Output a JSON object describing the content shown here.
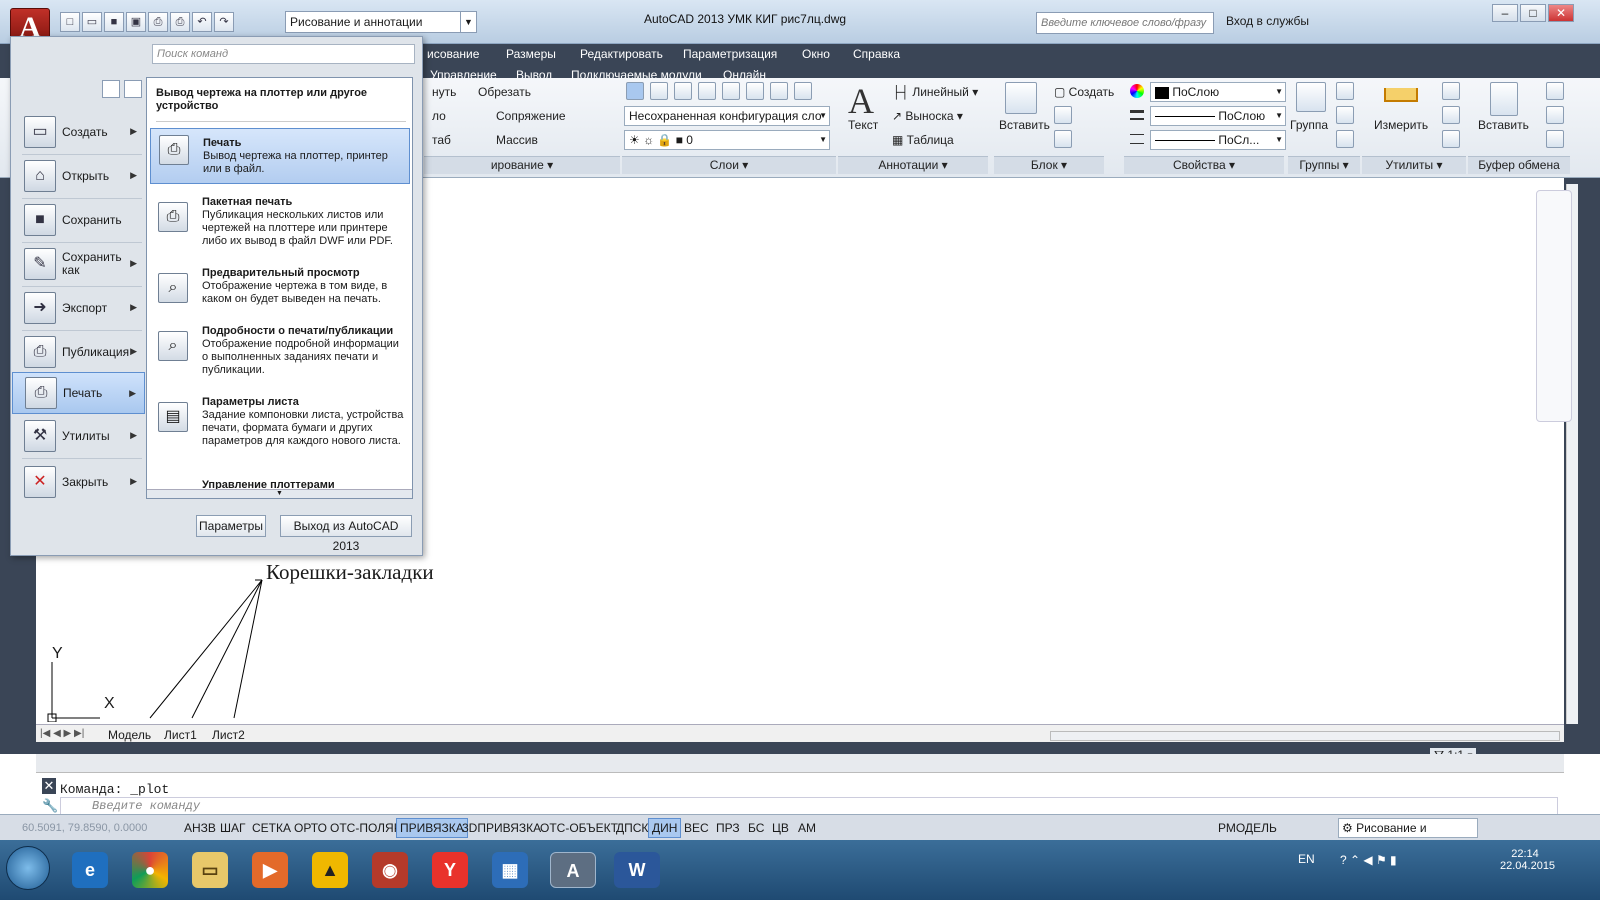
{
  "title_bar": {
    "app_title": "AutoCAD 2013     УМК КИГ рис7лц.dwg",
    "workspace": "Рисование и аннотации",
    "search_placeholder": "Введите ключевое слово/фразу",
    "services": "Вход в службы",
    "app_logo": "A"
  },
  "menubar": {
    "row1": [
      "исование",
      "Размеры",
      "Редактировать",
      "Параметризация",
      "Окно",
      "Справка"
    ],
    "row2": [
      "Управление",
      "Вывод",
      "Подключаемые модули",
      "Онлайн"
    ]
  },
  "ribbon": {
    "modify": {
      "items": [
        "нуть",
        "Обрезать",
        "ло",
        "Сопряжение",
        "таб",
        "Массив"
      ],
      "title": "ирование"
    },
    "layers": {
      "layer_state": "Несохраненная конфигурация сло",
      "current_layer": "0",
      "title": "Слои"
    },
    "annotation": {
      "text_label": "Текст",
      "linear": "Линейный",
      "leader": "Выноска",
      "table": "Таблица",
      "title": "Аннотации"
    },
    "block": {
      "insert": "Вставить",
      "create": "Создать",
      "title": "Блок"
    },
    "properties": {
      "color": "ПоСлою",
      "lineweight": "ПоСлою",
      "linetype": "ПоСл...",
      "title": "Свойства"
    },
    "groups": {
      "group": "Группа",
      "title": "Группы"
    },
    "utilities": {
      "measure": "Измерить",
      "title": "Утилиты"
    },
    "clipboard": {
      "paste": "Вставить",
      "title": "Буфер обмена"
    }
  },
  "app_menu": {
    "search_placeholder": "Поиск команд",
    "items": [
      {
        "label": "Создать",
        "icon": "new-document-icon"
      },
      {
        "label": "Открыть",
        "icon": "open-folder-icon"
      },
      {
        "label": "Сохранить",
        "icon": "save-disk-icon"
      },
      {
        "label": "Сохранить как",
        "icon": "save-as-icon"
      },
      {
        "label": "Экспорт",
        "icon": "export-icon"
      },
      {
        "label": "Публикация",
        "icon": "publish-icon"
      },
      {
        "label": "Печать",
        "icon": "printer-icon"
      },
      {
        "label": "Утилиты",
        "icon": "utilities-icon"
      },
      {
        "label": "Закрыть",
        "icon": "close-document-icon"
      }
    ],
    "print_submenu": {
      "heading": "Вывод чертежа на плоттер или другое устройство",
      "items": [
        {
          "title": "Печать",
          "desc": "Вывод чертежа на плоттер, принтер или в файл."
        },
        {
          "title": "Пакетная печать",
          "desc": "Публикация нескольких листов или чертежей на плоттере или принтере либо их вывод в файл DWF или PDF."
        },
        {
          "title": "Предварительный просмотр",
          "desc": "Отображение чертежа в том виде, в каком он будет выведен на печать."
        },
        {
          "title": "Подробности о печати/публикации",
          "desc": "Отображение подробной информации о выполненных заданиях печати и публикации."
        },
        {
          "title": "Параметры листа",
          "desc": "Задание компоновки листа, устройства печати, формата бумаги и других параметров для каждого нового листа."
        },
        {
          "title": "Управление плоттерами",
          "desc": ""
        }
      ]
    },
    "options_button": "Параметры",
    "exit_button": "Выход из AutoCAD 2013"
  },
  "drawing": {
    "annotation": "Корешки-закладки",
    "ucs_x": "X",
    "ucs_y": "Y"
  },
  "tabs": [
    "Модель",
    "Лист1",
    "Лист2"
  ],
  "command_line": {
    "history": "Команда:  _plot",
    "placeholder": "Введите команду"
  },
  "status_bar": {
    "coords": "60.5091, 79.8590, 0.0000",
    "toggles": [
      {
        "label": "АНЗВ",
        "on": false
      },
      {
        "label": "ШАГ",
        "on": false
      },
      {
        "label": "СЕТКА",
        "on": false
      },
      {
        "label": "ОРТО",
        "on": false
      },
      {
        "label": "ОТС-ПОЛЯР",
        "on": false
      },
      {
        "label": "ПРИВЯЗКА",
        "on": true
      },
      {
        "label": "3DПРИВЯЗКА",
        "on": false
      },
      {
        "label": "ОТС-ОБЪЕКТ",
        "on": false
      },
      {
        "label": "ДПСК",
        "on": false
      },
      {
        "label": "ДИН",
        "on": true
      },
      {
        "label": "ВЕС",
        "on": false
      },
      {
        "label": "ПРЗ",
        "on": false
      },
      {
        "label": "БС",
        "on": false
      },
      {
        "label": "ЦВ",
        "on": false
      },
      {
        "label": "АМ",
        "on": false
      }
    ],
    "model_space": "РМОДЕЛЬ",
    "workspace": "Рисование и аннотации",
    "scale": "1:1"
  },
  "taskbar": {
    "lang": "EN",
    "time": "22:14",
    "date": "22.04.2015"
  }
}
